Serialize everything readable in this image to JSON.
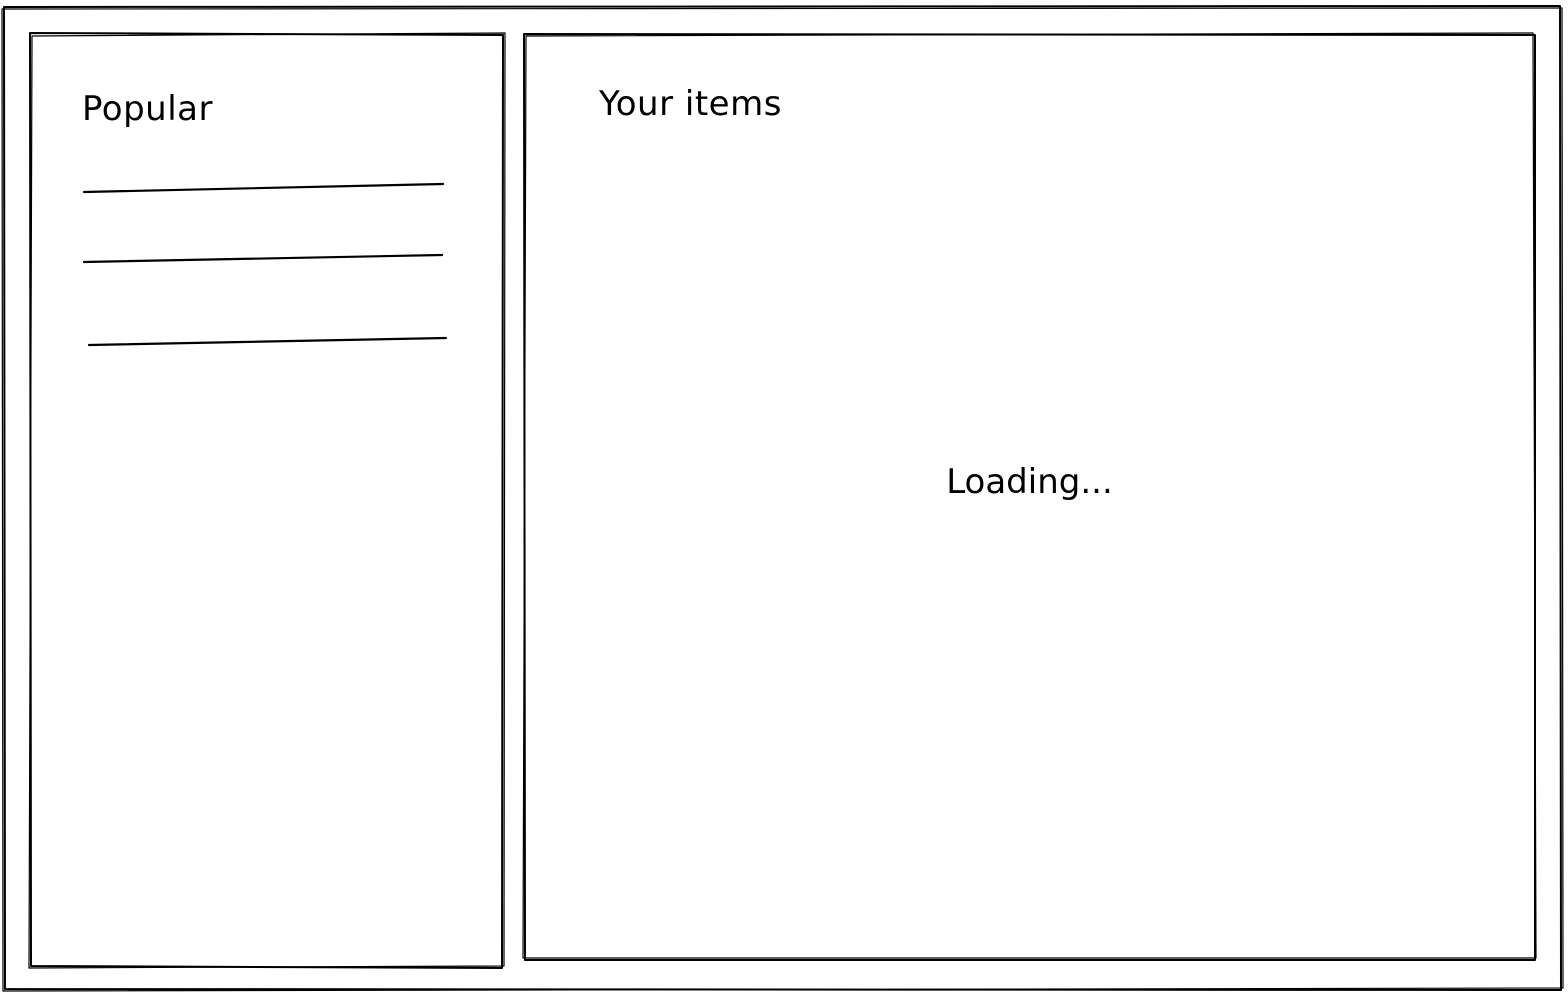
{
  "popular": {
    "title": "Popular",
    "items": [
      {
        "label": ""
      },
      {
        "label": ""
      },
      {
        "label": ""
      }
    ]
  },
  "items": {
    "title": "Your items",
    "status": "Loading..."
  }
}
